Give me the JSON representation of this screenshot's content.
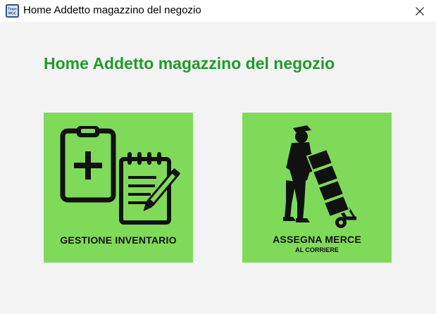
{
  "window": {
    "title": "Home Addetto magazzino del negozio",
    "app_icon_text_top": "Team",
    "app_icon_text_bottom": "MGC"
  },
  "main": {
    "heading": "Home Addetto magazzino del negozio",
    "tiles": [
      {
        "label": "GESTIONE INVENTARIO",
        "icon": "clipboard-notepad-icon"
      },
      {
        "label": "ASSEGNA MERCE",
        "sublabel": "AL CORRIERE",
        "icon": "delivery-man-hand-truck-icon"
      }
    ]
  },
  "colors": {
    "heading": "#209a2a",
    "tile_background": "#80da5a",
    "window_background": "#f3f3f3"
  }
}
